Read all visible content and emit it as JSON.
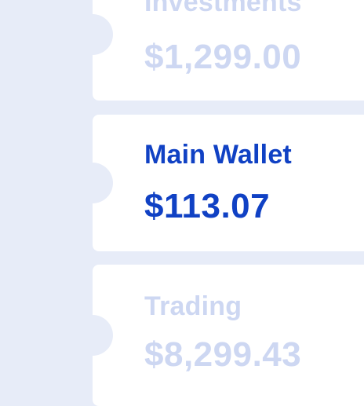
{
  "wallets": [
    {
      "name": "Investments",
      "balance": "$1,299.00",
      "state": "inactive"
    },
    {
      "name": "Main Wallet",
      "balance": "$113.07",
      "state": "selected"
    },
    {
      "name": "Trading",
      "balance": "$8,299.43",
      "state": "inactive"
    }
  ],
  "colors": {
    "background": "#e7ecf8",
    "card": "#ffffff",
    "active_text": "#1041c4",
    "muted_text": "#cdd7f2"
  }
}
